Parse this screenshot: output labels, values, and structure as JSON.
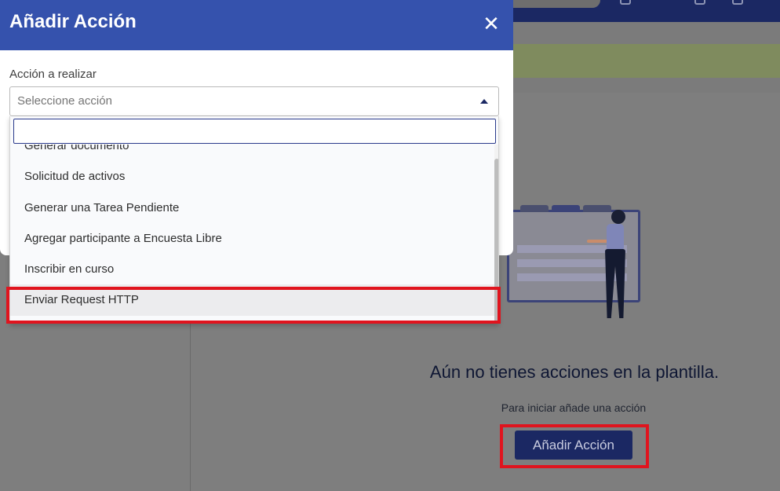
{
  "modal": {
    "title": "Añadir Acción",
    "close_symbol": "✕",
    "field_label": "Acción a realizar",
    "select_placeholder": "Seleccione acción",
    "search_value": "",
    "options": [
      "Generar documento",
      "Solicitud de activos",
      "Generar una Tarea Pendiente",
      "Agregar participante a Encuesta Libre",
      "Inscribir en curso",
      "Enviar Request HTTP"
    ],
    "selected_option": "Enviar Request HTTP"
  },
  "empty_state": {
    "title": "Aún no tienes acciones en la plantilla.",
    "subtitle": "Para iniciar añade una acción",
    "button_label": "Añadir Acción"
  },
  "icons": {
    "close": "close-icon",
    "caret": "caret-up-icon",
    "illustration": "empty-state-illustration"
  },
  "colors": {
    "header_blue": "#3552ad",
    "navy": "#1b2863",
    "highlight_red": "#e0141e"
  }
}
